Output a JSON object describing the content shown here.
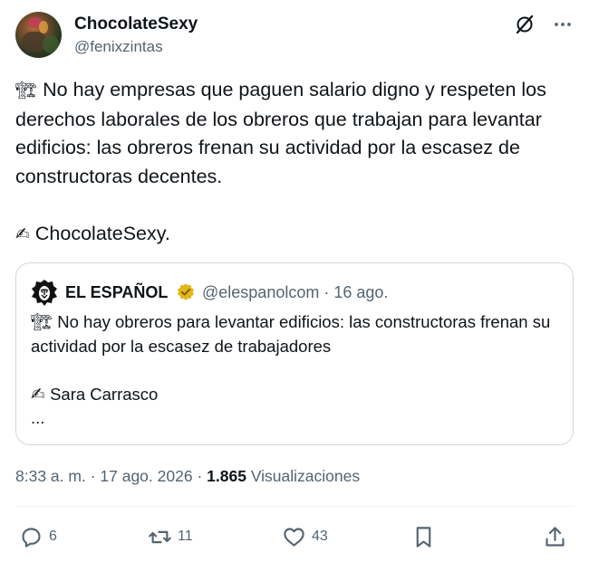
{
  "author": {
    "display_name": "ChocolateSexy",
    "handle": "@fenixzintas"
  },
  "tweet": {
    "text_line1": "No hay empresas que paguen salario digno y respeten los derechos laborales de los obreros que trabajan para levantar edificios: las obreros frenan su actividad por la escasez de constructoras decentes.",
    "signature": "ChocolateSexy.",
    "emoji_crane": "🏗",
    "emoji_pen": "✍"
  },
  "quote": {
    "display_name": "EL ESPAÑOL",
    "handle": "@elespanolcom",
    "date": "16 ago.",
    "text": "No hay obreros para levantar edificios: las constructoras frenan su actividad por la escasez de trabajadores",
    "signature": "Sara Carrasco",
    "ellipsis": "..."
  },
  "meta": {
    "time": "8:33 a. m.",
    "date": "17 ago. 2026",
    "views_count": "1.865",
    "views_label": "Visualizaciones"
  },
  "actions": {
    "replies": "6",
    "retweets": "11",
    "likes": "43"
  },
  "colors": {
    "text": "#0f1419",
    "secondary": "#536471",
    "border": "#cfd9de",
    "verified_gold": "#e2b719"
  },
  "icons": [
    "grok-icon",
    "more-icon",
    "verified-icon",
    "reply-icon",
    "retweet-icon",
    "like-icon",
    "bookmark-icon",
    "share-icon"
  ]
}
